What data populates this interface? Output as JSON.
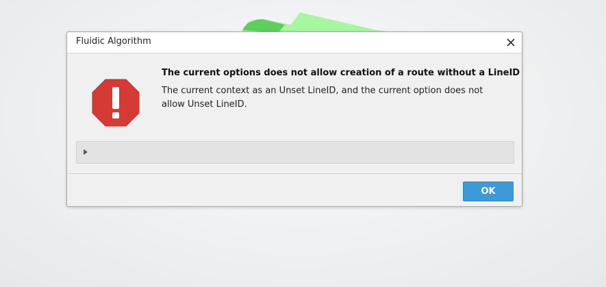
{
  "dialog": {
    "title": "Fluidic Algorithm",
    "close_icon": "close-icon",
    "status_icon": "error-stop-icon",
    "heading": "The current options does not allow creation of a route without a LineID",
    "message": "The current context as an Unset LineID, and the current option does not allow Unset LineID.",
    "details_icon": "expand-arrow-icon",
    "ok_label": "OK"
  },
  "colors": {
    "error_red": "#d63a34",
    "ok_button": "#3c9ad8",
    "dialog_bg": "#f0f0f0",
    "titlebar_bg": "#ffffff",
    "background_shape": "#9ef59a"
  }
}
